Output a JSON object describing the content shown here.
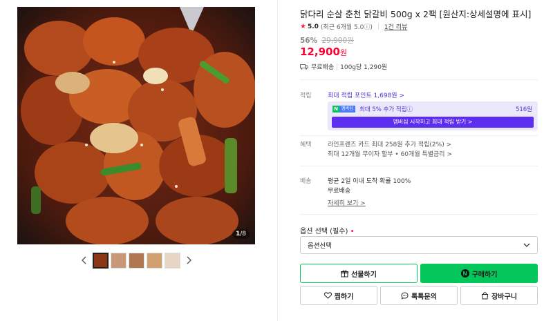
{
  "gallery": {
    "counter_current": "1",
    "counter_total": "/8",
    "prev_icon": "chevron-left-icon",
    "next_icon": "chevron-right-icon",
    "thumbnail_count": 5
  },
  "product": {
    "title": "닭다리 순살 춘천 닭갈비 500g x 2팩 [원산지:상세설명에 표시]",
    "rating_score": "5.0",
    "rating_detail": "(최근 6개월 5.0ⓘ)",
    "review_link": "1건 리뷰",
    "discount_rate": "56%",
    "original_price": "29,900원",
    "price_value": "12,900",
    "price_unit": "원",
    "shipping_label": "무료배송",
    "unit_price": "100g당 1,290원"
  },
  "points": {
    "label": "적립",
    "max_points_link": "최대 적립 포인트 1,698원 >",
    "membership_text": "최대 5% 추가 적립ⓘ",
    "membership_amount": "516원",
    "membership_button": "멤버십 시작하고 최대 적립 받기 >",
    "badge_n": "N",
    "badge_plus": "멤버십"
  },
  "benefits": {
    "label": "혜택",
    "line1": "라인프렌즈 카드 최대 258원 추가 적립(2%) >",
    "line2": "최대 12개월 무이자 할부 • 60개월 특별금리 >"
  },
  "delivery": {
    "label": "배송",
    "line1": "평균 2일 이내 도착 확률 100%",
    "line2": "무료배송",
    "detail_link": "자세히 보기 >"
  },
  "options": {
    "label": "옵션 선택 (필수)",
    "required_mark": "•",
    "selected_value": "옵션선택"
  },
  "actions": {
    "gift": "선물하기",
    "buy": "구매하기",
    "buy_badge": "N",
    "wish": "찜하기",
    "talk": "톡톡문의",
    "cart": "장바구니"
  },
  "colors": {
    "price_red": "#ff0033",
    "naver_green": "#03c75a",
    "membership_purple": "#5c2ef0"
  }
}
